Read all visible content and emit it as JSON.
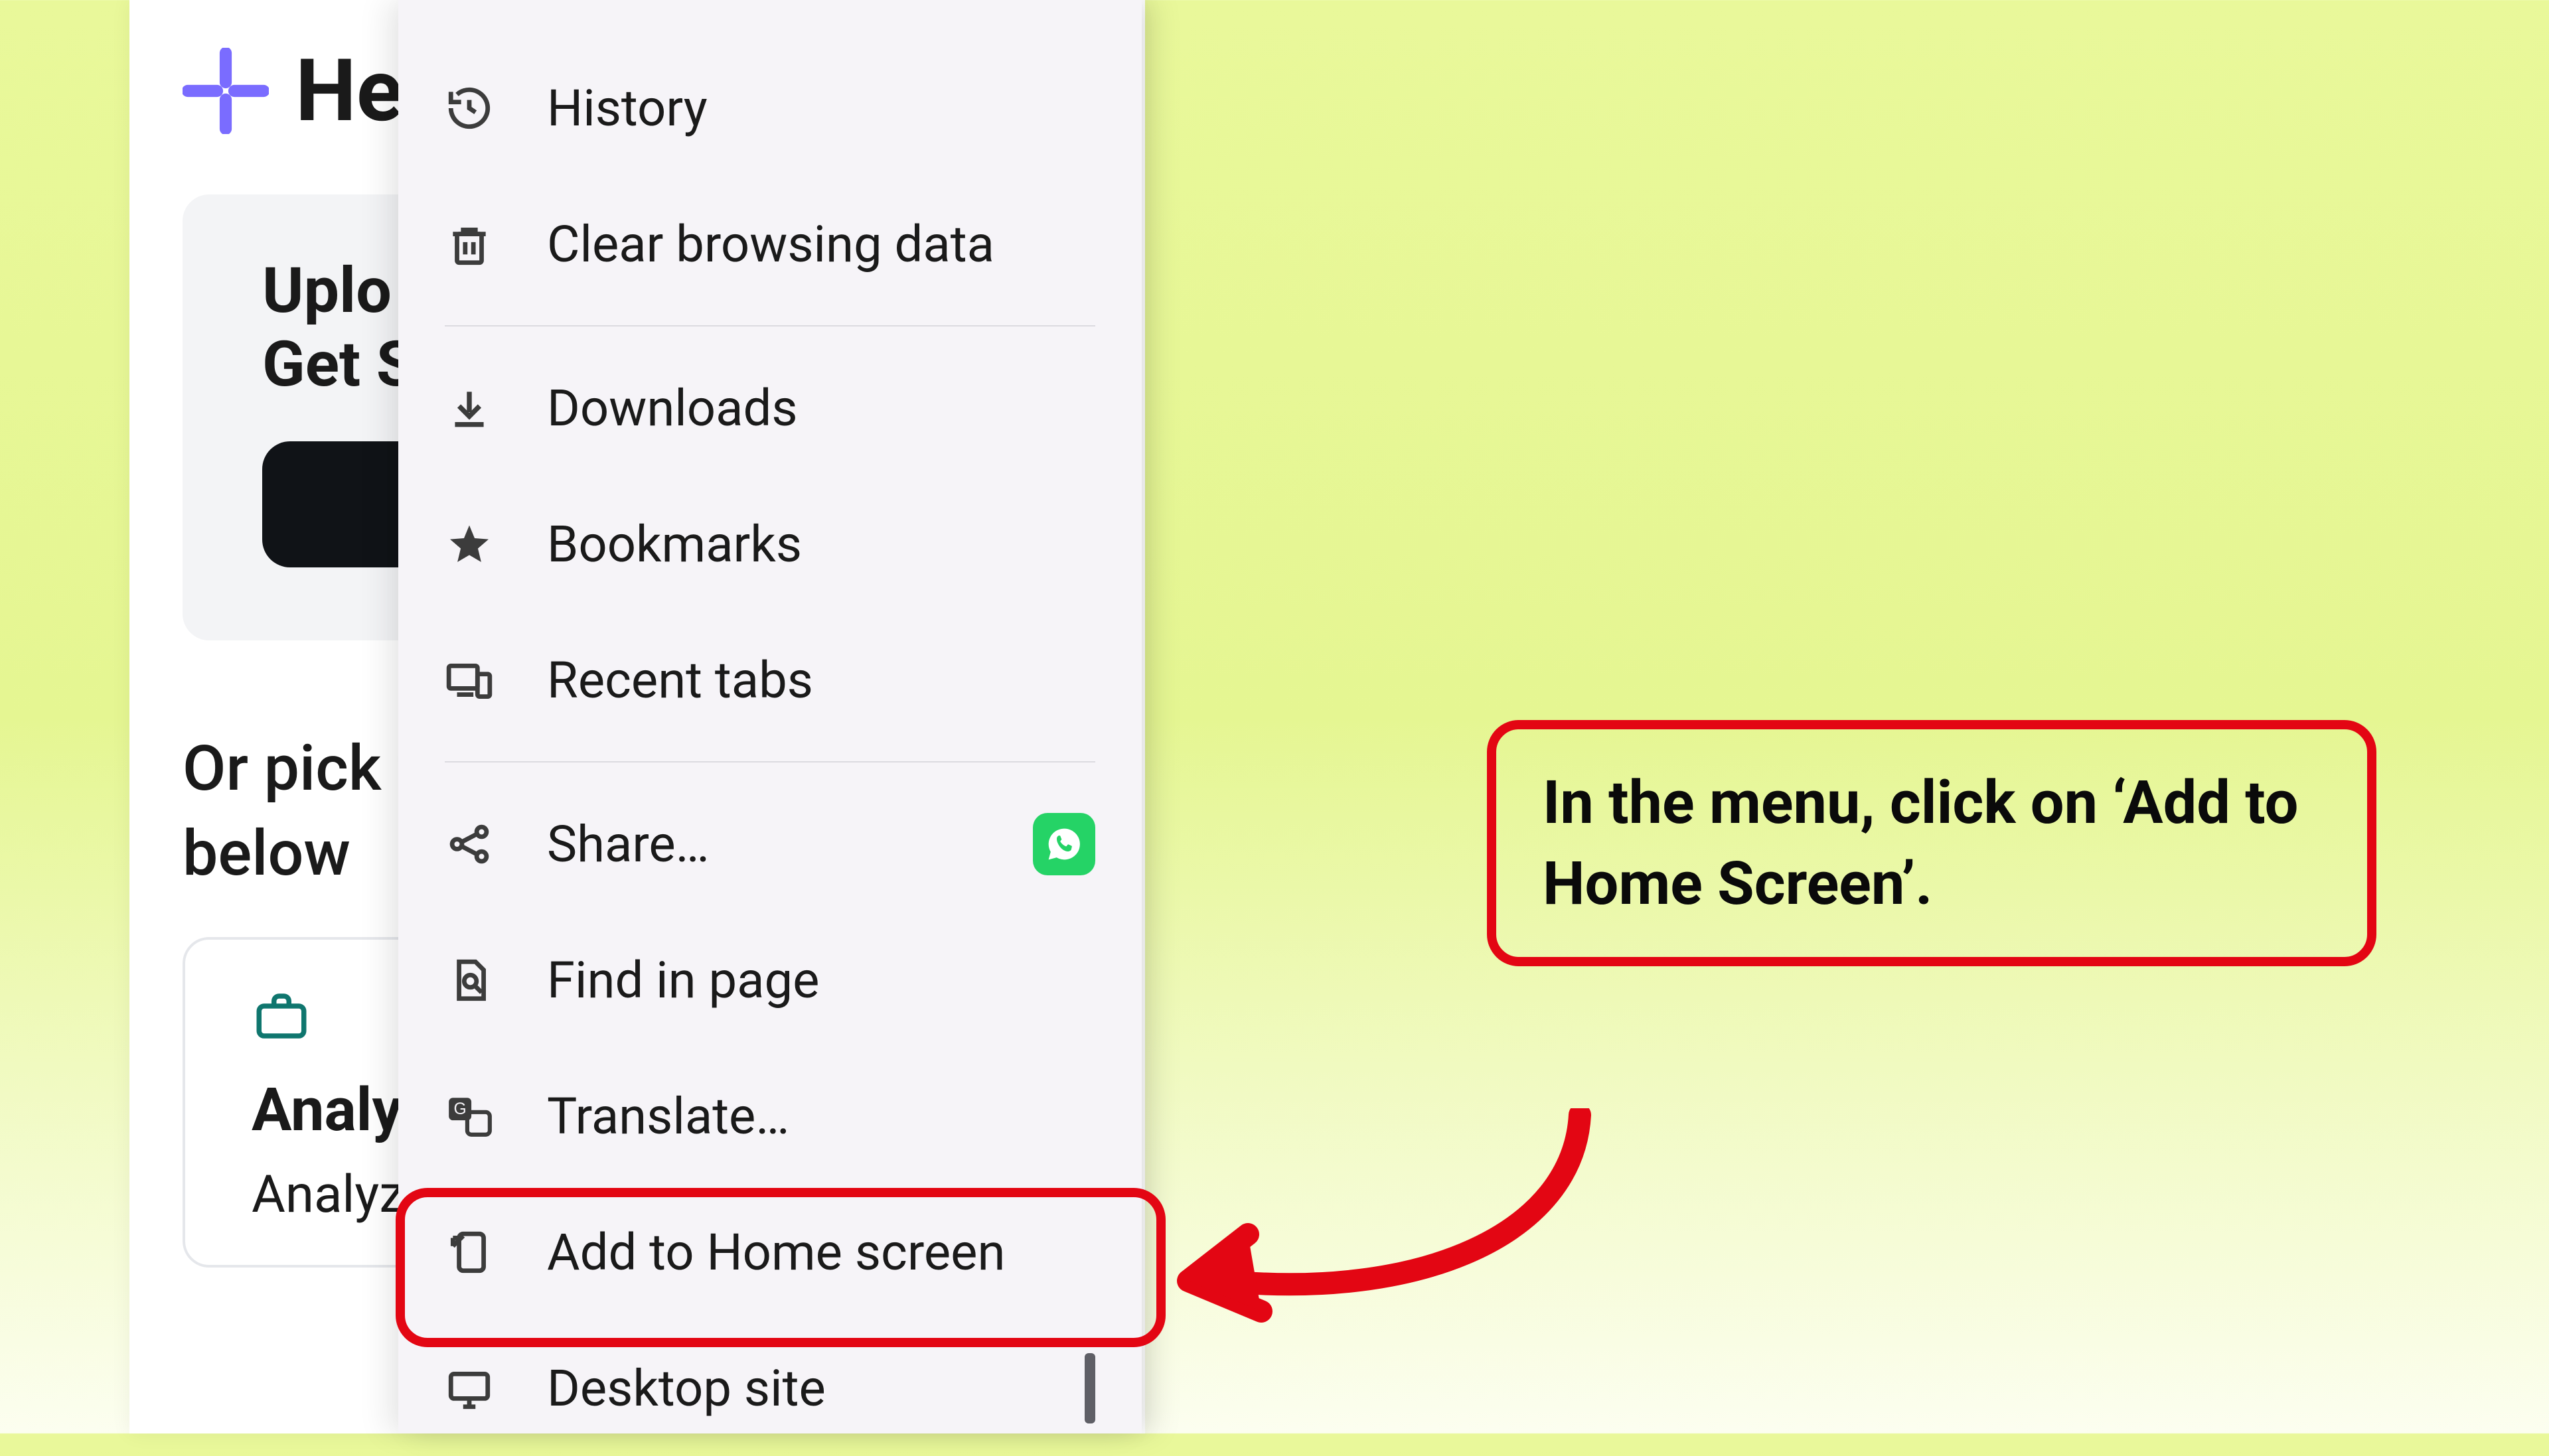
{
  "app": {
    "title_visible": "He",
    "upload_line1_visible": "Uplo",
    "upload_line2_visible": "Get S",
    "pick_line1_visible": "Or pick f",
    "pick_line2": "below",
    "analyze_title_visible": "Analyze",
    "analyze_sub_visible": "Analyze"
  },
  "menu": {
    "history": "History",
    "clear_data": "Clear browsing data",
    "downloads": "Downloads",
    "bookmarks": "Bookmarks",
    "recent_tabs": "Recent tabs",
    "share": "Share…",
    "find_in_page": "Find in page",
    "translate": "Translate…",
    "add_to_home": "Add to Home screen",
    "desktop_site": "Desktop site"
  },
  "callout": {
    "text": "In the menu, click on ‘Add to Home Screen’."
  },
  "colors": {
    "accent_red": "#e30613",
    "whatsapp_green": "#25d366",
    "logo_purple": "#7a6cff"
  }
}
